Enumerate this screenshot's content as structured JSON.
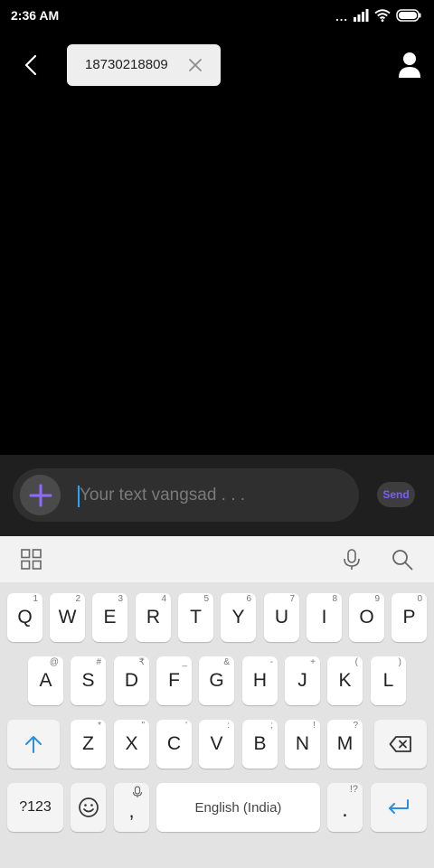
{
  "status_bar": {
    "time": "2:36 AM",
    "dots": "...",
    "icons": [
      "signal-icon",
      "wifi-icon",
      "battery-icon"
    ]
  },
  "header": {
    "recipient": "18730218809",
    "icons": [
      "back-arrow-icon",
      "close-icon",
      "contact-icon"
    ]
  },
  "compose": {
    "placeholder": "Your text vangsad . . .",
    "value": "",
    "send_label": "Send",
    "accent_color": "#7b5cff",
    "cursor_color": "#2aa5ff"
  },
  "keyboard_toolbar": {
    "icons": [
      "apps-grid-icon",
      "microphone-icon",
      "search-icon"
    ]
  },
  "keyboard": {
    "row1": [
      {
        "label": "Q",
        "hint": "1"
      },
      {
        "label": "W",
        "hint": "2"
      },
      {
        "label": "E",
        "hint": "3"
      },
      {
        "label": "R",
        "hint": "4"
      },
      {
        "label": "T",
        "hint": "5"
      },
      {
        "label": "Y",
        "hint": "6"
      },
      {
        "label": "U",
        "hint": "7"
      },
      {
        "label": "I",
        "hint": "8"
      },
      {
        "label": "O",
        "hint": "9"
      },
      {
        "label": "P",
        "hint": "0"
      }
    ],
    "row2": [
      {
        "label": "A",
        "hint": "@"
      },
      {
        "label": "S",
        "hint": "#"
      },
      {
        "label": "D",
        "hint": "₹"
      },
      {
        "label": "F",
        "hint": "_"
      },
      {
        "label": "G",
        "hint": "&"
      },
      {
        "label": "H",
        "hint": "-"
      },
      {
        "label": "J",
        "hint": "+"
      },
      {
        "label": "K",
        "hint": "("
      },
      {
        "label": "L",
        "hint": ")"
      }
    ],
    "row3": [
      {
        "label": "Z",
        "hint": "*"
      },
      {
        "label": "X",
        "hint": "\""
      },
      {
        "label": "C",
        "hint": "'"
      },
      {
        "label": "V",
        "hint": ":"
      },
      {
        "label": "B",
        "hint": ";"
      },
      {
        "label": "N",
        "hint": "!"
      },
      {
        "label": "M",
        "hint": "?"
      }
    ],
    "symbols_label": "?123",
    "comma_label": ",",
    "space_label": "English (India)",
    "period_label": ".",
    "period_hint": "!?",
    "special_icons": [
      "shift-arrow-icon",
      "backspace-icon",
      "emoji-icon",
      "enter-arrow-icon"
    ]
  }
}
